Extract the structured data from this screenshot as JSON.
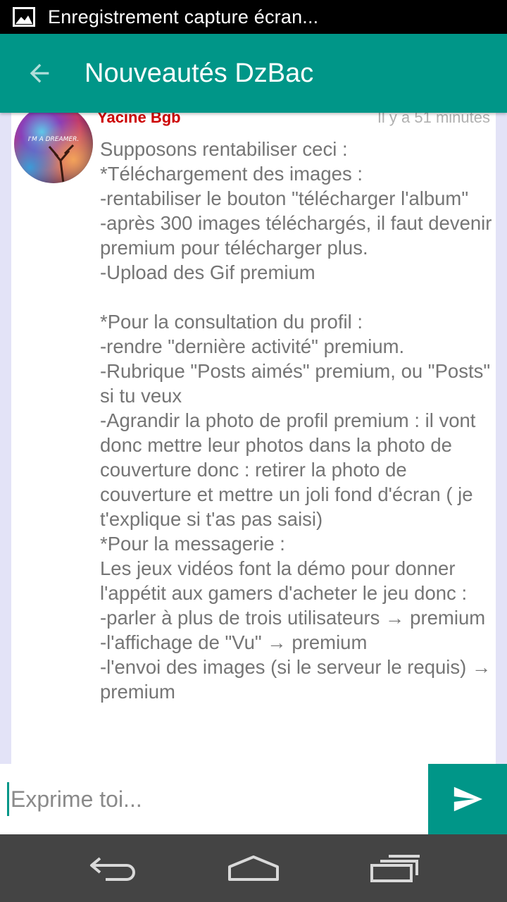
{
  "status_bar": {
    "notification_text": "Enregistrement capture écran...",
    "icon": "image-icon"
  },
  "app_bar": {
    "title": "Nouveautés DzBac",
    "back_icon": "arrow-back-icon",
    "color": "#009688"
  },
  "post": {
    "author": "Yacine Bgb",
    "time": "Il y a 51 minutes",
    "avatar_text": "I'M A DREAMER.",
    "message": "Supposons rentabiliser ceci :\n*Téléchargement des images :\n-rentabiliser le bouton \"télécharger l'album\"\n-après 300 images téléchargés, il faut devenir premium pour télécharger plus.\n-Upload des Gif premium\n\n*Pour la consultation du profil :\n-rendre \"dernière activité\" premium.\n-Rubrique \"Posts aimés\" premium, ou \"Posts\" si tu veux\n-Agrandir la photo de profil premium : il vont donc mettre leur photos dans la photo de couverture donc : retirer la photo de couverture et mettre un joli fond d'écran ( je t'explique si t'as pas saisi)\n*Pour la messagerie :\nLes jeux vidéos font la démo pour donner l'appétit aux gamers d'acheter le jeu donc :\n-parler à plus de trois utilisateurs → premium\n-l'affichage de \"Vu\" → premium\n-l'envoi des images (si le serveur le requis) → premium"
  },
  "composer": {
    "placeholder": "Exprime toi...",
    "send_icon": "send-icon"
  },
  "nav_bar": {
    "back_icon": "nav-back-icon",
    "home_icon": "nav-home-icon",
    "recents_icon": "nav-recents-icon"
  }
}
